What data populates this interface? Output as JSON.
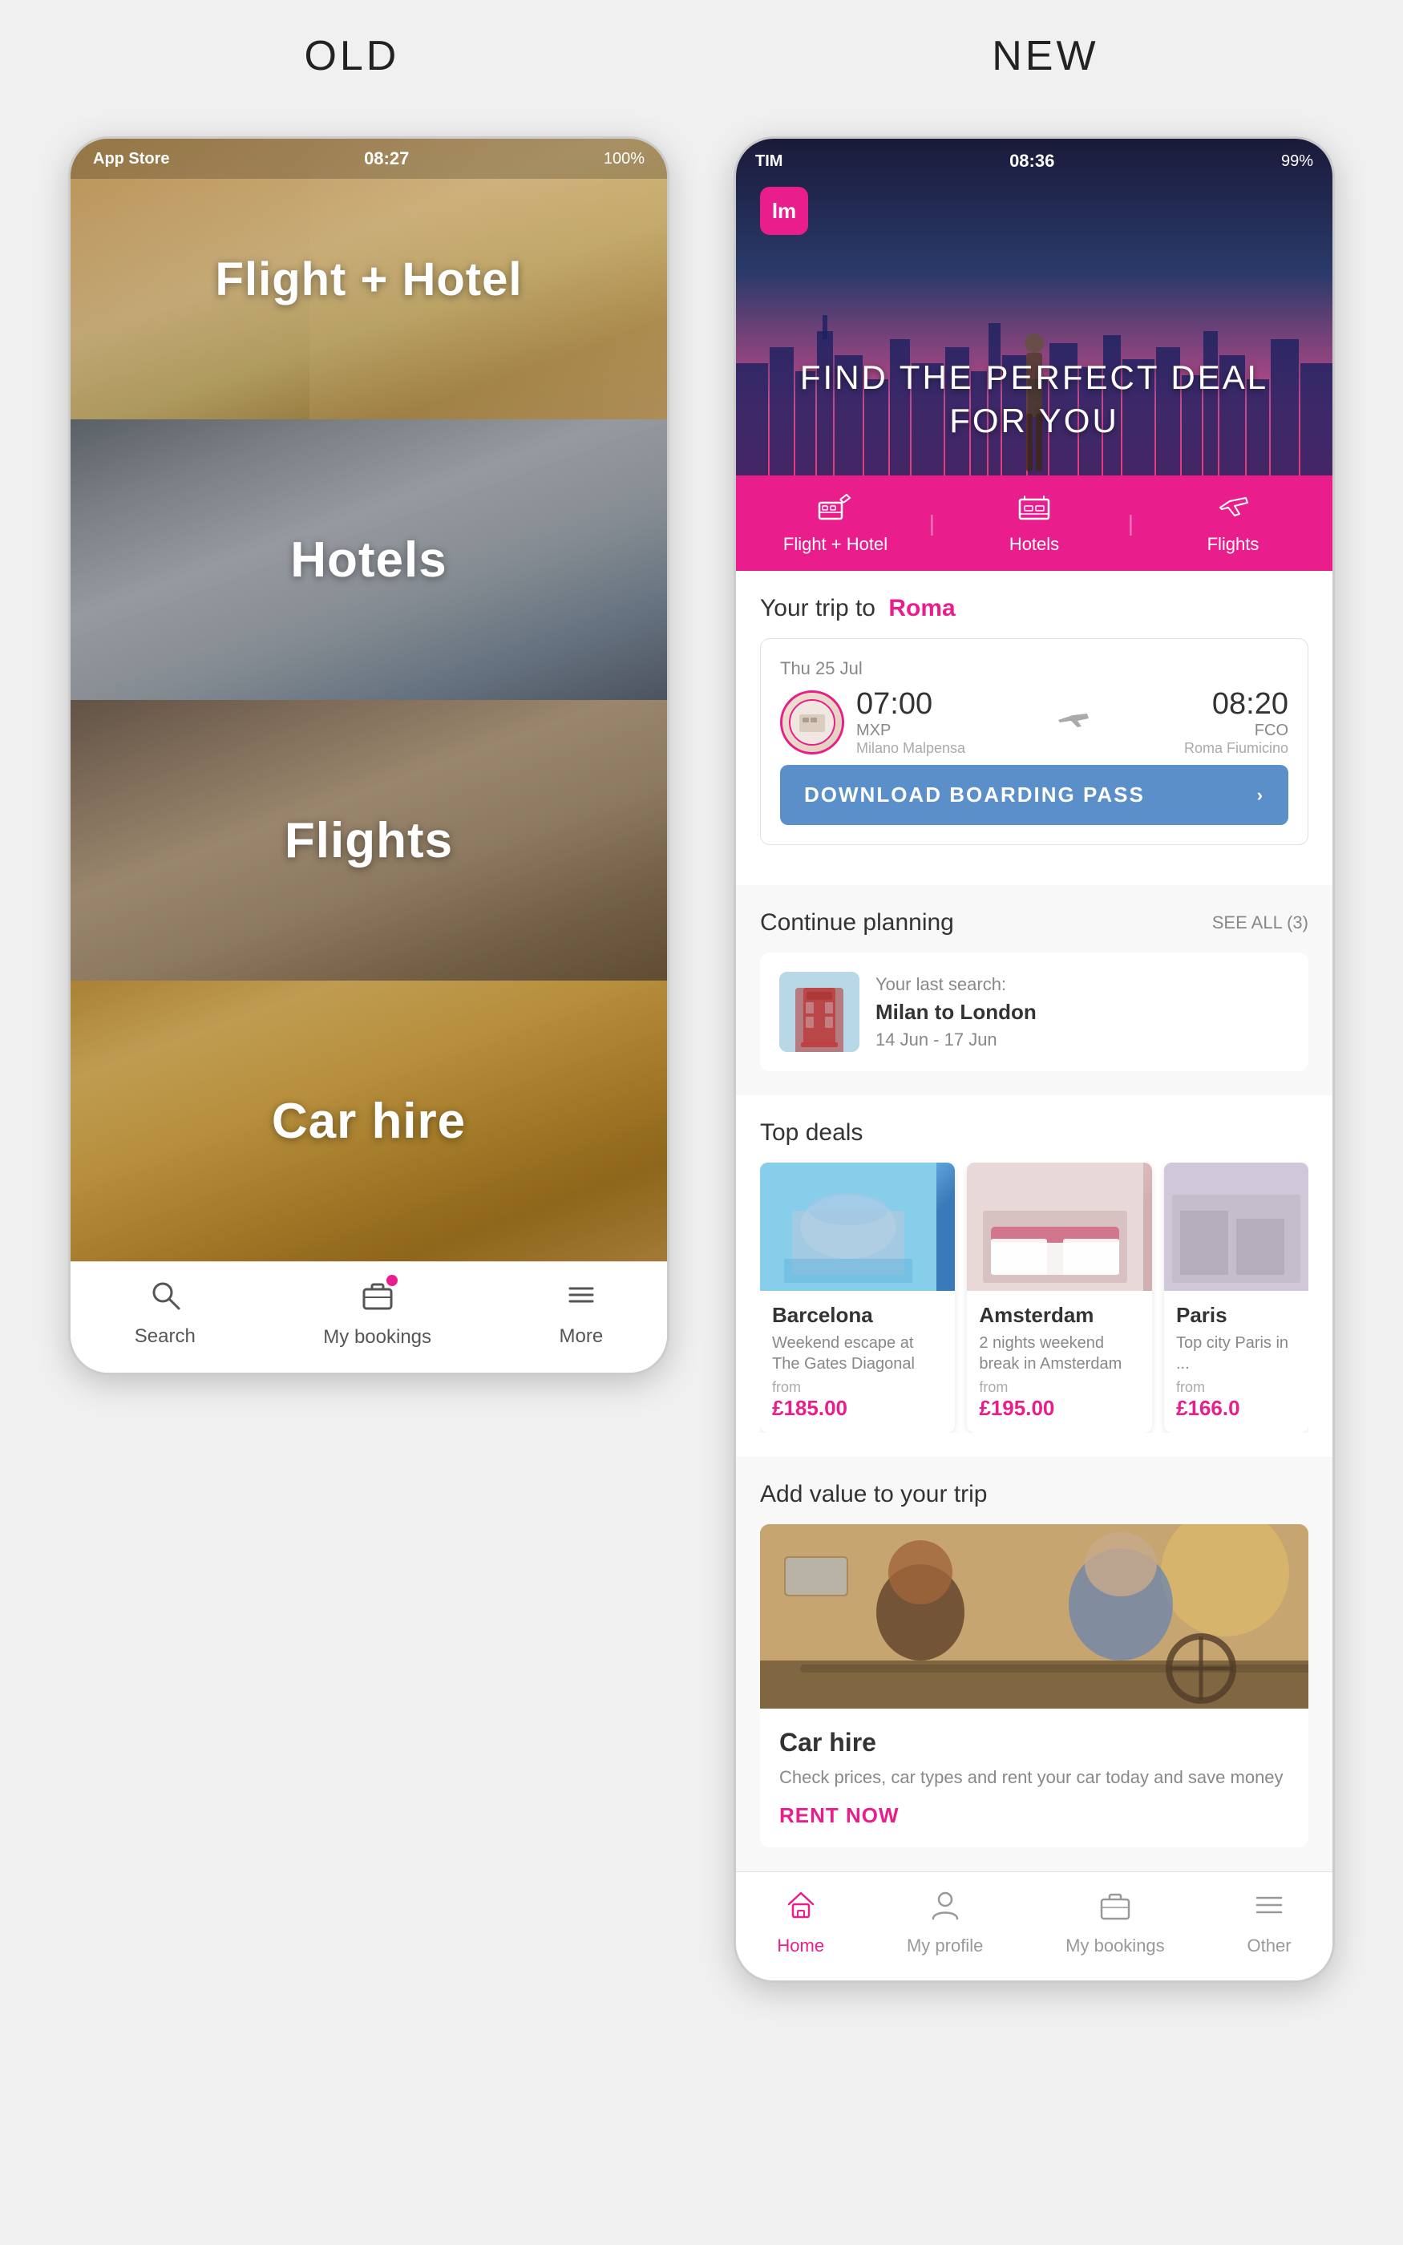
{
  "page": {
    "old_label": "OLD",
    "new_label": "NEW"
  },
  "old_phone": {
    "status_bar": {
      "carrier": "App Store",
      "time": "08:27",
      "battery": "100%"
    },
    "menu_items": [
      {
        "label": "Flight + Hotel",
        "index": 0
      },
      {
        "label": "Hotels",
        "index": 1
      },
      {
        "label": "Flights",
        "index": 2
      },
      {
        "label": "Car hire",
        "index": 3
      }
    ],
    "bottom_nav": [
      {
        "label": "Search",
        "icon": "search",
        "has_dot": false
      },
      {
        "label": "My bookings",
        "icon": "briefcase",
        "has_dot": true
      },
      {
        "label": "More",
        "icon": "menu",
        "has_dot": false
      }
    ]
  },
  "new_phone": {
    "status_bar": {
      "carrier": "TIM",
      "time": "08:36",
      "battery": "99%"
    },
    "logo": "lm",
    "hero_tagline_line1": "FIND THE PERFECT DEAL",
    "hero_tagline_line2": "FOR YOU",
    "category_tabs": [
      {
        "label": "Flight + Hotel",
        "icon": "plane-hotel"
      },
      {
        "label": "Hotels",
        "icon": "bed"
      },
      {
        "label": "Flights",
        "icon": "plane"
      }
    ],
    "trip_section": {
      "prefix": "Your trip to",
      "destination": "Roma",
      "flight": {
        "date": "Thu 25 Jul",
        "depart_time": "07:00",
        "depart_code": "MXP",
        "depart_city": "Milano Malpensa",
        "arrive_time": "08:20",
        "arrive_code": "FCO",
        "arrive_city": "Roma Fiumicino"
      },
      "boarding_pass_btn": "DOWNLOAD BOARDING PASS"
    },
    "continue_planning": {
      "title": "Continue planning",
      "see_all": "SEE ALL (3)",
      "last_search": {
        "subtitle": "Your last search:",
        "route": "Milan to London",
        "dates": "14 Jun - 17 Jun"
      }
    },
    "top_deals": {
      "title": "Top deals",
      "deals": [
        {
          "city": "Barcelona",
          "desc": "Weekend escape at The Gates Diagonal",
          "from_label": "from",
          "price": "£185.00",
          "color": "barcelona"
        },
        {
          "city": "Amsterdam",
          "desc": "2 nights weekend break in Amsterdam",
          "from_label": "from",
          "price": "£195.00",
          "color": "amsterdam"
        },
        {
          "city": "Paris",
          "desc": "Top city Paris in ...",
          "from_label": "from",
          "price": "£166.0",
          "color": "paris"
        }
      ]
    },
    "add_value": {
      "title": "Add value to your trip",
      "car_hire": {
        "title": "Car hire",
        "desc": "Check prices, car types and rent your car today and save money",
        "cta": "RENT NOW"
      }
    },
    "bottom_nav": [
      {
        "label": "Home",
        "icon": "home",
        "active": true
      },
      {
        "label": "My profile",
        "icon": "person",
        "active": false
      },
      {
        "label": "My bookings",
        "icon": "briefcase",
        "active": false
      },
      {
        "label": "Other",
        "icon": "menu",
        "active": false
      }
    ]
  }
}
